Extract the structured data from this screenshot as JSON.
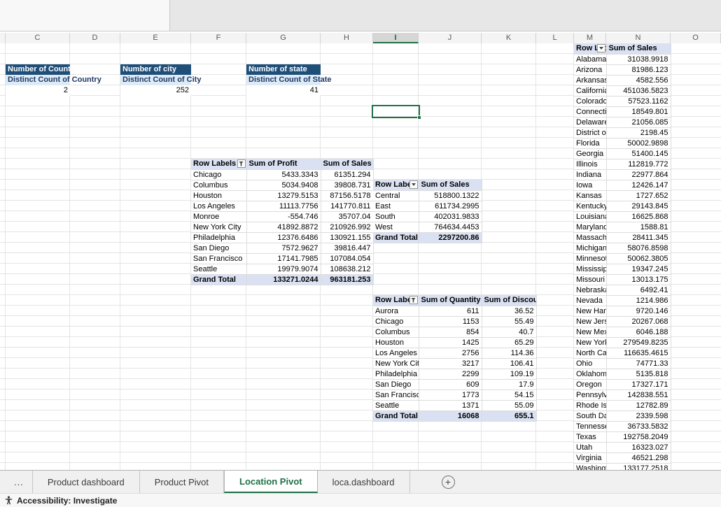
{
  "app": {
    "columns": [
      "C",
      "D",
      "E",
      "F",
      "G",
      "H",
      "I",
      "J",
      "K",
      "L",
      "M",
      "N",
      "O"
    ],
    "selected_column": "I"
  },
  "colors": {
    "accent_green": "#1e7145",
    "metric_header_fill": "#1f4e79",
    "metric_label_fill": "#ddebf7",
    "pivot_header_fill": "#d9e1f2"
  },
  "metrics": [
    {
      "title": "Number of Country",
      "label": "Distinct Count of Country",
      "value": "2"
    },
    {
      "title": "Number of city",
      "label": "Distinct Count of City",
      "value": "252"
    },
    {
      "title": "Number of state",
      "label": "Distinct Count of State",
      "value": "41"
    }
  ],
  "city_pivot": {
    "headers": [
      "Row Labels",
      "Sum of Profit",
      "Sum of Sales"
    ],
    "rows": [
      [
        "Chicago",
        "5433.3343",
        "61351.294"
      ],
      [
        "Columbus",
        "5034.9408",
        "39808.731"
      ],
      [
        "Houston",
        "13279.5153",
        "87156.5178"
      ],
      [
        "Los Angeles",
        "11113.7756",
        "141770.811"
      ],
      [
        "Monroe",
        "-554.746",
        "35707.04"
      ],
      [
        "New York City",
        "41892.8872",
        "210926.992"
      ],
      [
        "Philadelphia",
        "12376.6486",
        "130921.155"
      ],
      [
        "San Diego",
        "7572.9627",
        "39816.447"
      ],
      [
        "San Francisco",
        "17141.7985",
        "107084.054"
      ],
      [
        "Seattle",
        "19979.9074",
        "108638.212"
      ]
    ],
    "total": [
      "Grand Total",
      "133271.0244",
      "963181.253"
    ]
  },
  "region_pivot": {
    "headers": [
      "Row Labels",
      "Sum of Sales"
    ],
    "rows": [
      [
        "Central",
        "518800.1322"
      ],
      [
        "East",
        "611734.2995"
      ],
      [
        "South",
        "402031.9833"
      ],
      [
        "West",
        "764634.4453"
      ]
    ],
    "total": [
      "Grand Total",
      "2297200.86"
    ]
  },
  "quantity_pivot": {
    "headers": [
      "Row Labels",
      "Sum of Quantity",
      "Sum of Discount"
    ],
    "rows": [
      [
        "Aurora",
        "611",
        "36.52"
      ],
      [
        "Chicago",
        "1153",
        "55.49"
      ],
      [
        "Columbus",
        "854",
        "40.7"
      ],
      [
        "Houston",
        "1425",
        "65.29"
      ],
      [
        "Los Angeles",
        "2756",
        "114.36"
      ],
      [
        "New York City",
        "3217",
        "106.41"
      ],
      [
        "Philadelphia",
        "2299",
        "109.19"
      ],
      [
        "San Diego",
        "609",
        "17.9"
      ],
      [
        "San Francisco",
        "1773",
        "54.15"
      ],
      [
        "Seattle",
        "1371",
        "55.09"
      ]
    ],
    "total": [
      "Grand Total",
      "16068",
      "655.1"
    ]
  },
  "state_pivot": {
    "headers": [
      "Row Labels",
      "Sum of Sales"
    ],
    "rows": [
      [
        "Alabama",
        "31038.9918"
      ],
      [
        "Arizona",
        "81986.123"
      ],
      [
        "Arkansas",
        "4582.556"
      ],
      [
        "California",
        "451036.5823"
      ],
      [
        "Colorado",
        "57523.1162"
      ],
      [
        "Connecticut",
        "18549.801"
      ],
      [
        "Delaware",
        "21056.085"
      ],
      [
        "District of Columbia",
        "2198.45"
      ],
      [
        "Florida",
        "50002.9898"
      ],
      [
        "Georgia",
        "51400.145"
      ],
      [
        "Illinois",
        "112819.772"
      ],
      [
        "Indiana",
        "22977.864"
      ],
      [
        "Iowa",
        "12426.147"
      ],
      [
        "Kansas",
        "1727.652"
      ],
      [
        "Kentucky",
        "29143.845"
      ],
      [
        "Louisiana",
        "16625.868"
      ],
      [
        "Maryland",
        "1588.81"
      ],
      [
        "Massachusetts",
        "28411.345"
      ],
      [
        "Michigan",
        "58076.8598"
      ],
      [
        "Minnesota",
        "50062.3805"
      ],
      [
        "Mississippi",
        "19347.245"
      ],
      [
        "Missouri",
        "13013.175"
      ],
      [
        "Nebraska",
        "6492.41"
      ],
      [
        "Nevada",
        "1214.986"
      ],
      [
        "New Hampshire",
        "9720.146"
      ],
      [
        "New Jersey",
        "20267.068"
      ],
      [
        "New Mexico",
        "6046.188"
      ],
      [
        "New York",
        "279549.8235"
      ],
      [
        "North Carolina",
        "116635.4615"
      ],
      [
        "Ohio",
        "74771.33"
      ],
      [
        "Oklahoma",
        "5135.818"
      ],
      [
        "Oregon",
        "17327.171"
      ],
      [
        "Pennsylvania",
        "142838.551"
      ],
      [
        "Rhode Island",
        "12782.89"
      ],
      [
        "South Dakota",
        "2339.598"
      ],
      [
        "Tennessee",
        "36733.5832"
      ],
      [
        "Texas",
        "192758.2049"
      ],
      [
        "Utah",
        "16323.027"
      ],
      [
        "Virginia",
        "46521.298"
      ],
      [
        "Washington",
        "133177.2518"
      ]
    ]
  },
  "sheet_tabs": {
    "overflow": "...",
    "tabs": [
      {
        "label": "Product dashboard",
        "active": false
      },
      {
        "label": "Product Pivot",
        "active": false
      },
      {
        "label": "Location Pivot",
        "active": true
      },
      {
        "label": "loca.dashboard",
        "active": false
      }
    ],
    "add_label": "+"
  },
  "status_bar": {
    "accessibility": "Accessibility: Investigate"
  }
}
